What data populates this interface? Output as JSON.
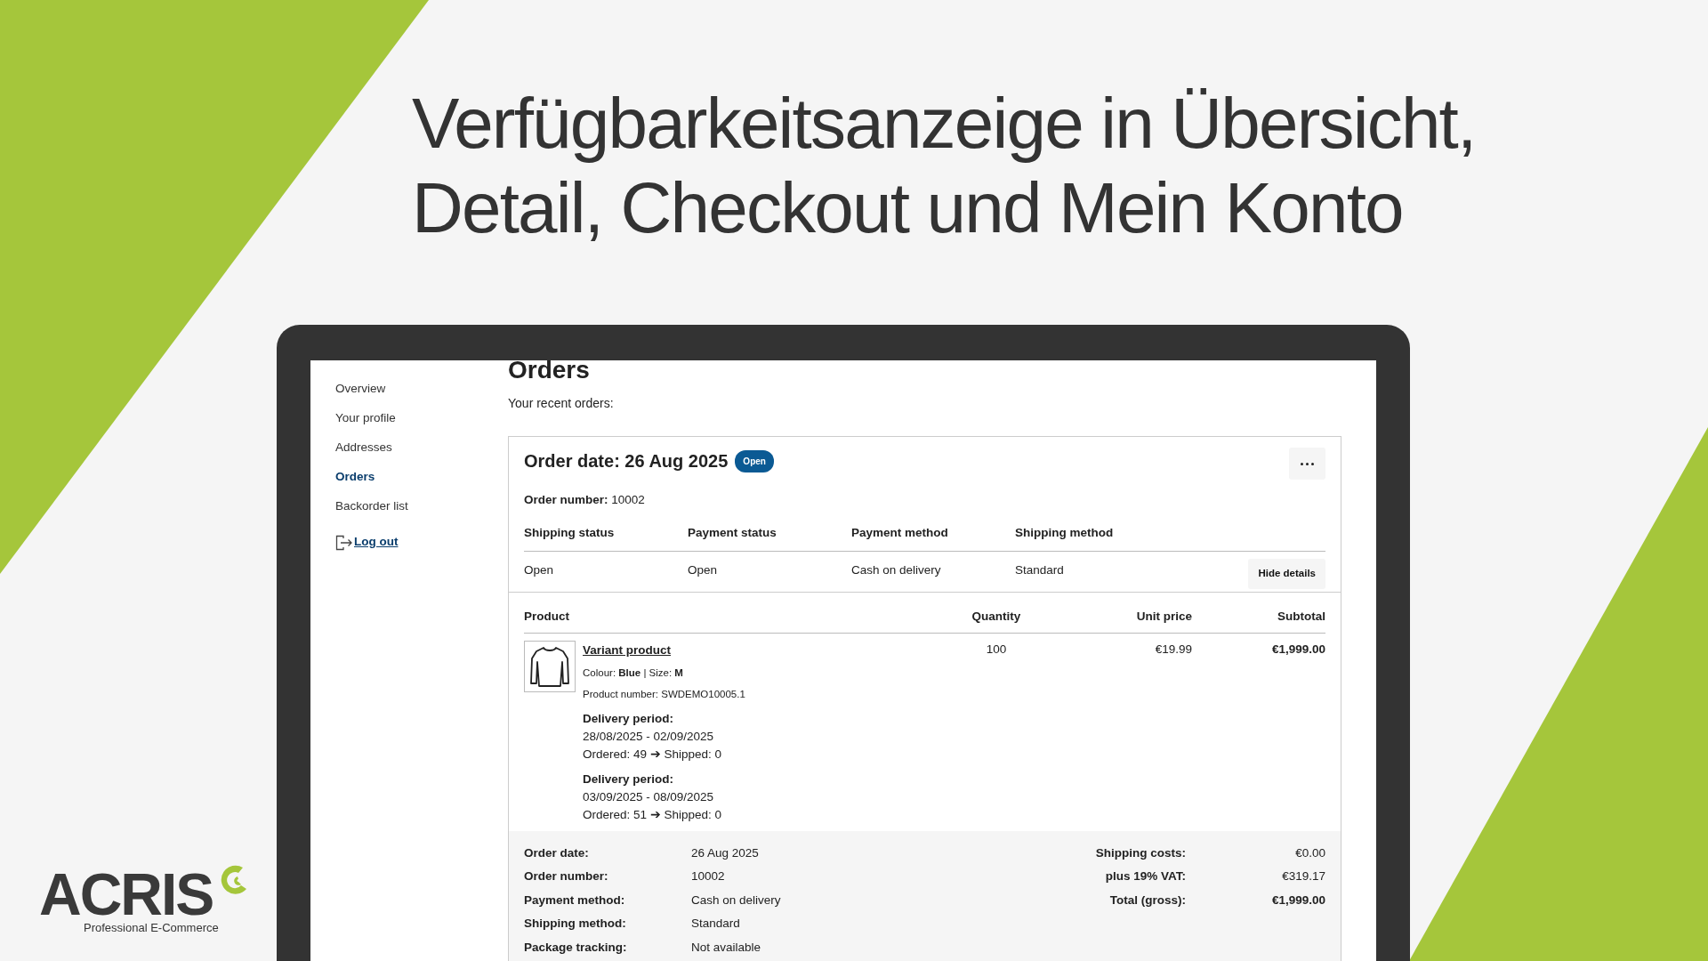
{
  "headline": [
    "Verfügbarkeitsanzeige in Übersicht,",
    "Detail, Checkout und Mein Konto"
  ],
  "sidebar": {
    "items": [
      {
        "label": "Overview",
        "kind": "link",
        "selected": false
      },
      {
        "label": "Your profile",
        "kind": "link",
        "selected": false
      },
      {
        "label": "Addresses",
        "kind": "link",
        "selected": false
      },
      {
        "label": "Orders",
        "kind": "link",
        "selected": true
      },
      {
        "label": "Backorder list",
        "kind": "link",
        "selected": false
      },
      {
        "label": "Log out",
        "kind": "logout",
        "selected": false
      }
    ]
  },
  "page": {
    "title": "Orders",
    "subtitle": "Your recent orders:"
  },
  "order": {
    "title": "Order date: 26 Aug 2025",
    "status_badge": "Open",
    "number_label": "Order number:",
    "number_value": "10002",
    "info": [
      {
        "label": "Shipping status",
        "value": "Open"
      },
      {
        "label": "Payment status",
        "value": "Open"
      },
      {
        "label": "Payment method",
        "value": "Cash on delivery"
      },
      {
        "label": "Shipping method",
        "value": "Standard"
      }
    ],
    "hide_details": "Hide details",
    "product_columns": [
      "Product",
      "Quantity",
      "Unit price",
      "Subtotal"
    ],
    "products": [
      {
        "name": "Variant product",
        "options": "Colour: **Blue** | Size: **M**",
        "product_number": "Product number: SWDEMO10005.1",
        "quantity": "100",
        "unit_price": "€19.99",
        "subtotal": "€1,999.00",
        "deliveries": [
          {
            "label": "Delivery period:",
            "range": "28/08/2025 - 02/09/2025",
            "status": "Ordered: 49 ➔ Shipped: 0"
          },
          {
            "label": "Delivery period:",
            "range": "03/09/2025 - 08/09/2025",
            "status": "Ordered: 51 ➔ Shipped: 0"
          }
        ]
      }
    ],
    "summary_left": [
      {
        "label": "Order date:",
        "value": "26 Aug 2025"
      },
      {
        "label": "Order number:",
        "value": "10002"
      },
      {
        "label": "Payment method:",
        "value": "Cash on delivery"
      },
      {
        "label": "Shipping method:",
        "value": "Standard"
      },
      {
        "label": "Package tracking:",
        "value": "Not available"
      }
    ],
    "summary_right": [
      {
        "label": "Shipping costs:",
        "value": "€0.00",
        "emphasized": false
      },
      {
        "label": "plus 19% VAT:",
        "value": "€319.17",
        "emphasized": false
      },
      {
        "label": "Total (gross):",
        "value": "€1,999.00",
        "emphasized": true
      }
    ]
  },
  "logo": {
    "name": "ACRIS",
    "tagline": "Professional E-Commerce"
  }
}
